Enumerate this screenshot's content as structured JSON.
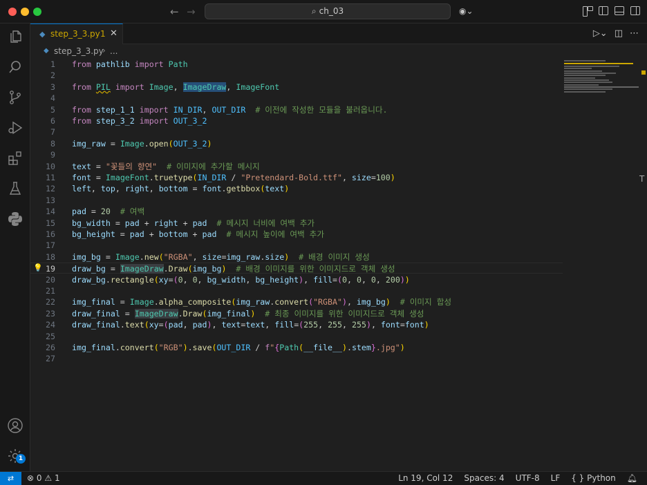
{
  "window": {
    "title": "ch_03"
  },
  "tab": {
    "label": "step_3_3.py",
    "problem_count": "1"
  },
  "breadcrumb": {
    "file": "step_3_3.py",
    "more": "..."
  },
  "activity_bar": {
    "icons": [
      "explorer-icon",
      "search-icon",
      "source-control-icon",
      "run-debug-icon",
      "extensions-icon",
      "testing-icon",
      "python-icon",
      "account-icon",
      "settings-icon"
    ],
    "settings_badge": "1"
  },
  "editor": {
    "current_line": 19,
    "line_numbers": [
      "1",
      "2",
      "3",
      "4",
      "5",
      "6",
      "7",
      "8",
      "9",
      "10",
      "11",
      "12",
      "13",
      "14",
      "15",
      "16",
      "17",
      "18",
      "19",
      "20",
      "21",
      "22",
      "23",
      "24",
      "25",
      "26",
      "27"
    ]
  },
  "status": {
    "errors": "0",
    "warnings": "1",
    "position": "Ln 19, Col 12",
    "spaces": "Spaces: 4",
    "encoding": "UTF-8",
    "eol": "LF",
    "language": "Python"
  },
  "colors": {
    "accent": "#0078d4",
    "warning": "#cca700",
    "background": "#1f1f1f"
  }
}
